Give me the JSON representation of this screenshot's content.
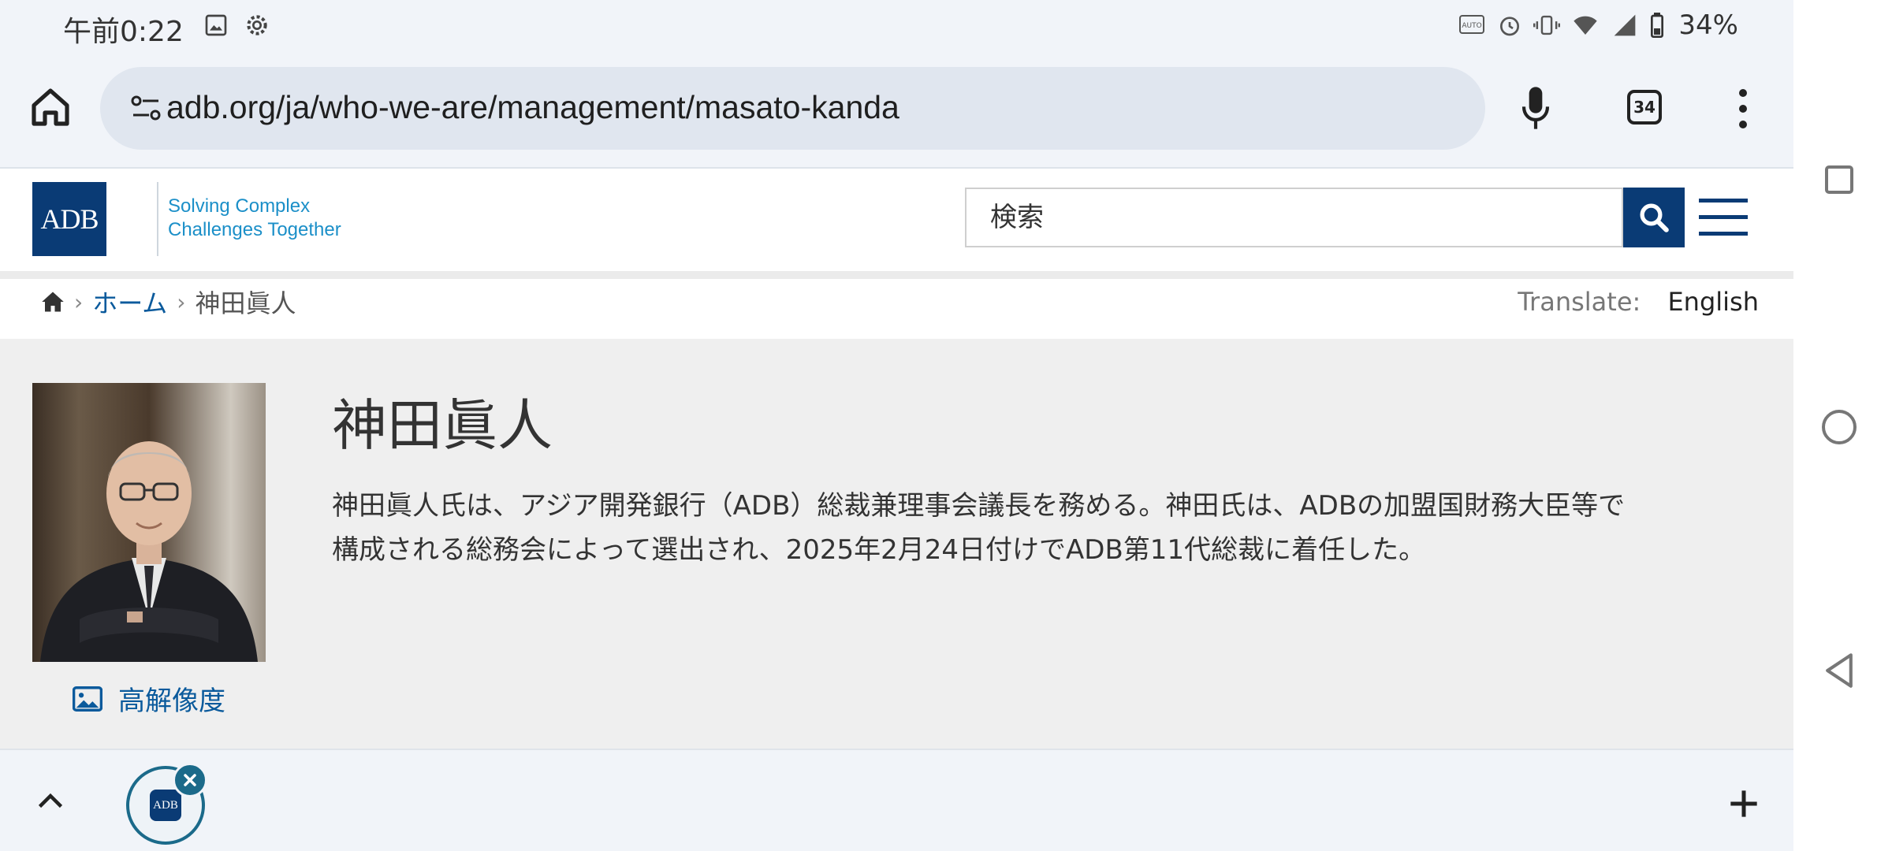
{
  "status_bar": {
    "time": "午前0:22",
    "battery": "34%"
  },
  "browser": {
    "url": "adb.org/ja/who-we-are/management/masato-kanda",
    "tab_count": "34"
  },
  "header": {
    "logo_text": "ADB",
    "tagline_line1": "Solving Complex",
    "tagline_line2": "Challenges Together",
    "search_placeholder": "検索"
  },
  "breadcrumb": {
    "home": "ホーム",
    "current": "神田眞人"
  },
  "translate": {
    "label": "Translate:",
    "language": "English"
  },
  "profile": {
    "name": "神田眞人",
    "bio_line1": "神田眞人氏は、アジア開発銀行（ADB）総裁兼理事会議長を務める。神田氏は、ADBの加盟国財務大臣等で",
    "bio_line2": "構成される総務会によって選出され、2025年2月24日付けでADB第11代総裁に着任した。",
    "hires_label": "高解像度"
  },
  "tab_strip": {
    "favicon_text": "ADB"
  },
  "colors": {
    "brand_navy": "#0a3b75",
    "link_blue": "#0a5a9c",
    "tagline_blue": "#1b8fc8",
    "tab_accent": "#1b6a8a"
  },
  "icons": [
    "image-icon",
    "gear-icon",
    "auto-hz-icon",
    "alarm-icon",
    "vibrate-icon",
    "wifi-icon",
    "signal-icon",
    "battery-icon",
    "home-icon",
    "site-settings-icon",
    "mic-icon",
    "more-vert-icon",
    "search-icon",
    "hamburger-icon",
    "breadcrumb-home-icon",
    "picture-icon",
    "chevron-up-icon",
    "close-icon",
    "plus-icon"
  ]
}
